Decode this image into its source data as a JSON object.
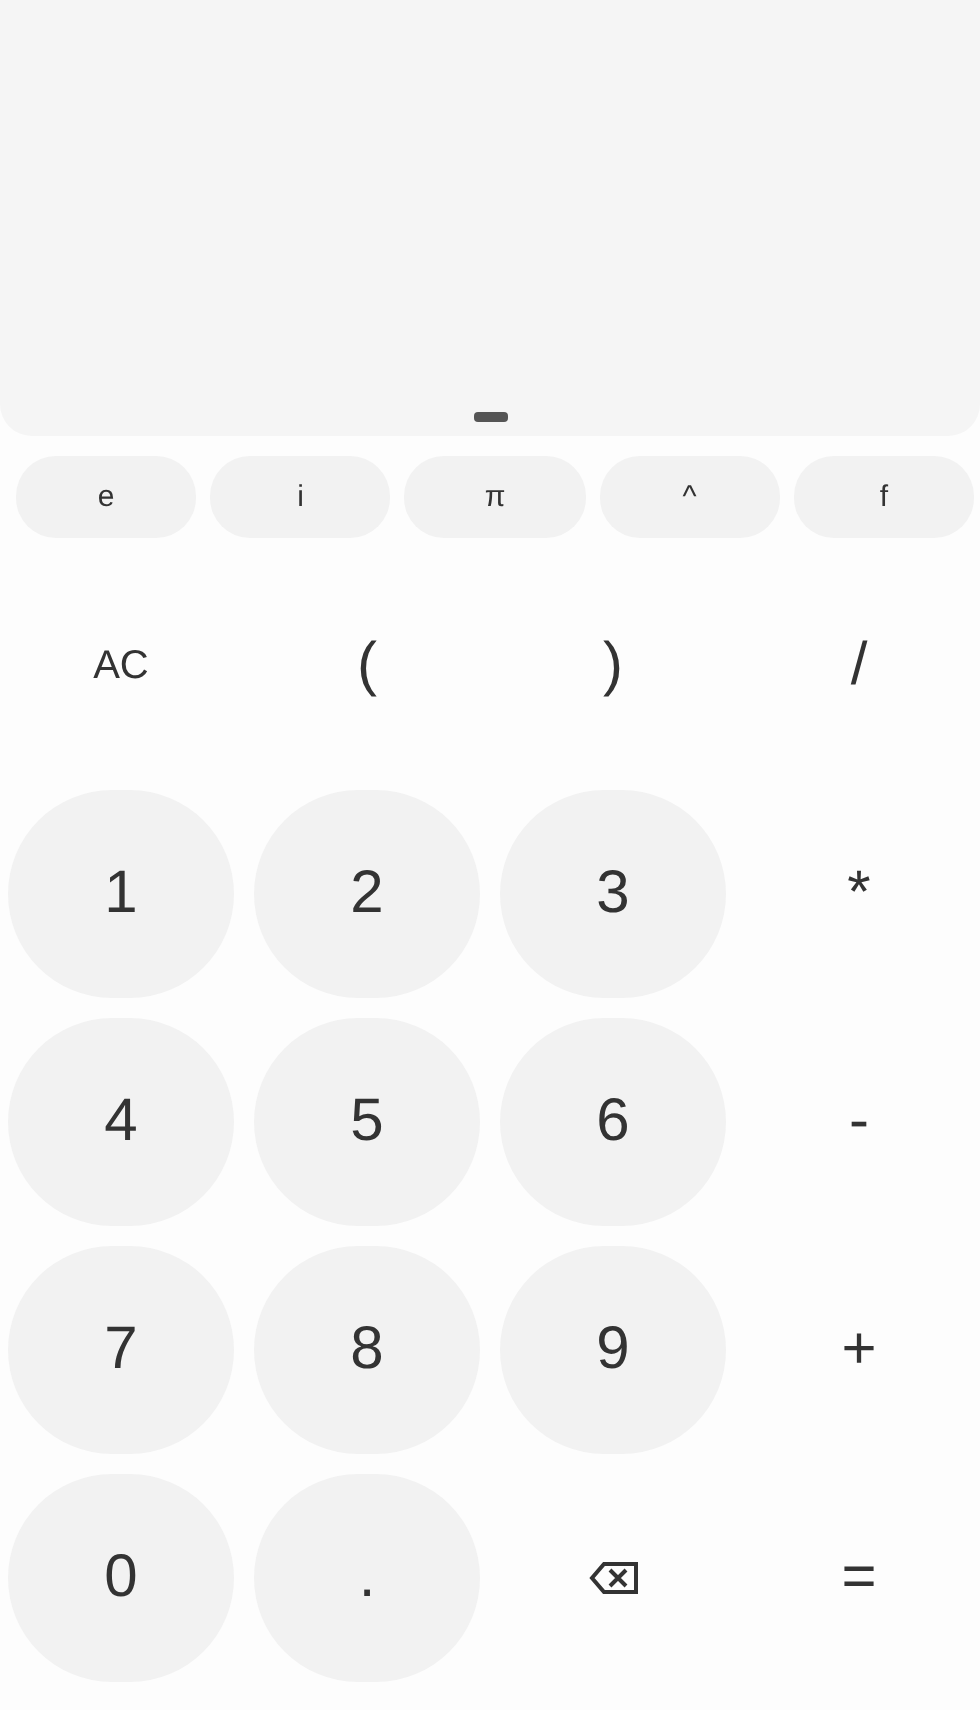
{
  "functions": [
    "e",
    "i",
    "π",
    "^",
    "f"
  ],
  "keys": [
    {
      "kind": "op",
      "label": "AC"
    },
    {
      "kind": "op",
      "label": "("
    },
    {
      "kind": "op",
      "label": ")"
    },
    {
      "kind": "op",
      "label": "/"
    },
    {
      "kind": "digit",
      "label": "1"
    },
    {
      "kind": "digit",
      "label": "2"
    },
    {
      "kind": "digit",
      "label": "3"
    },
    {
      "kind": "op",
      "label": "*"
    },
    {
      "kind": "digit",
      "label": "4"
    },
    {
      "kind": "digit",
      "label": "5"
    },
    {
      "kind": "digit",
      "label": "6"
    },
    {
      "kind": "op",
      "label": "-"
    },
    {
      "kind": "digit",
      "label": "7"
    },
    {
      "kind": "digit",
      "label": "8"
    },
    {
      "kind": "digit",
      "label": "9"
    },
    {
      "kind": "op",
      "label": "+"
    },
    {
      "kind": "digit",
      "label": "0"
    },
    {
      "kind": "digit",
      "label": "."
    },
    {
      "kind": "backspace"
    },
    {
      "kind": "op",
      "label": "="
    }
  ]
}
